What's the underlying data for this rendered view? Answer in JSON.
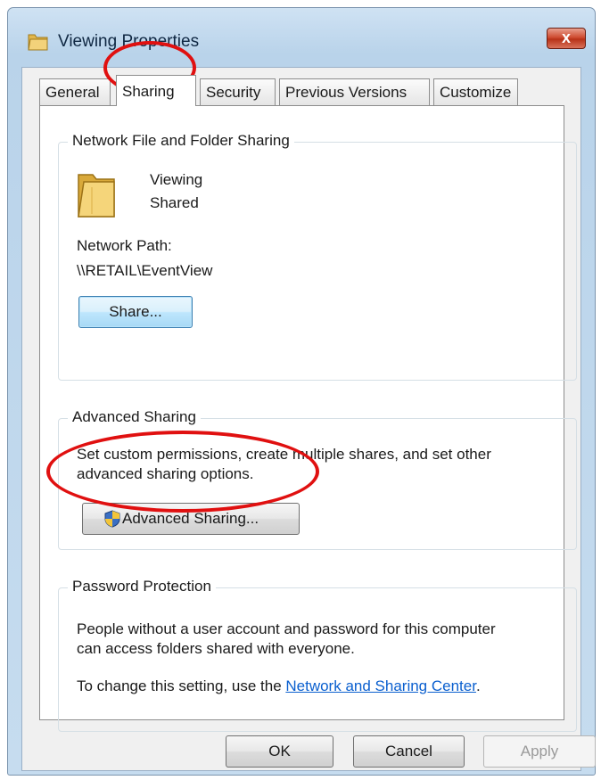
{
  "window": {
    "title": "Viewing Properties",
    "close_glyph": "x"
  },
  "tabs": [
    {
      "label": "General"
    },
    {
      "label": "Sharing"
    },
    {
      "label": "Security"
    },
    {
      "label": "Previous Versions"
    },
    {
      "label": "Customize"
    }
  ],
  "network_sharing": {
    "group_title": "Network File and Folder Sharing",
    "folder_name": "Viewing",
    "folder_status": "Shared",
    "path_label": "Network Path:",
    "path_value": "\\\\RETAIL\\EventView",
    "share_button": "Share..."
  },
  "advanced_sharing": {
    "group_title": "Advanced Sharing",
    "description_line1": "Set custom permissions, create multiple shares, and set other",
    "description_line2": "advanced sharing options.",
    "button_label": "Advanced Sharing..."
  },
  "password_protection": {
    "group_title": "Password Protection",
    "text_line1": "People without a user account and password for this computer",
    "text_line2": "can access folders shared with everyone.",
    "change_prefix": "To change this setting, use the ",
    "link_text": "Network and Sharing Center",
    "change_suffix": "."
  },
  "footer": {
    "ok": "OK",
    "cancel": "Cancel",
    "apply": "Apply"
  },
  "colors": {
    "annotation": "#e01010",
    "link": "#0a5fcf",
    "title_bar": "#c6dcef"
  }
}
